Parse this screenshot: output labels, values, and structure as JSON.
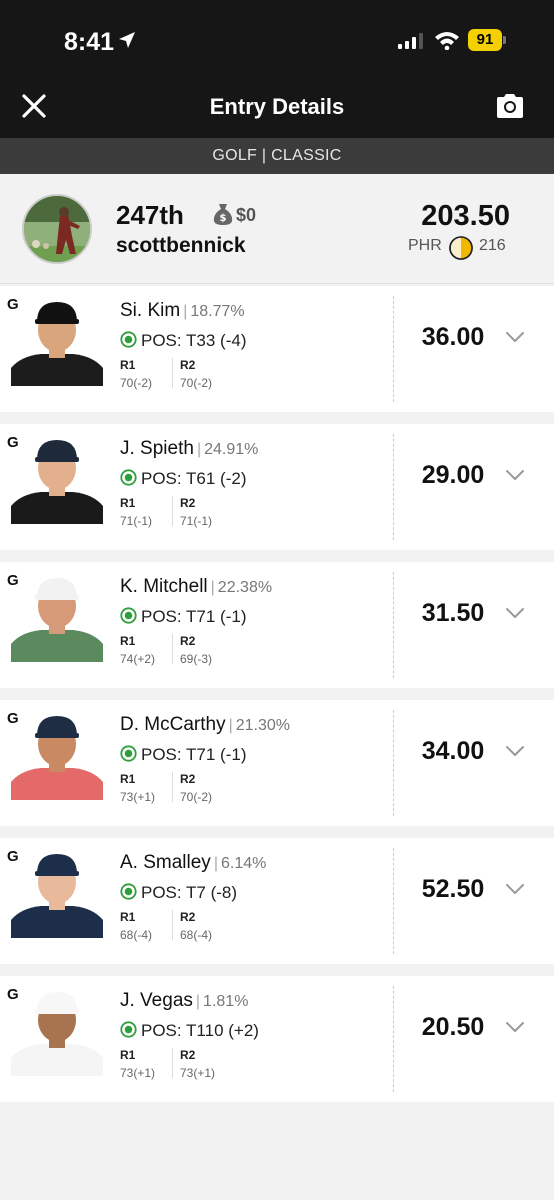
{
  "status_bar": {
    "time": "8:41",
    "battery": "91"
  },
  "header": {
    "title": "Entry Details",
    "close_icon": "close-icon",
    "camera_icon": "camera-icon"
  },
  "subheader": {
    "label": "GOLF | CLASSIC"
  },
  "summary": {
    "rank": "247th",
    "winnings": "$0",
    "username": "scottbennick",
    "score": "203.50",
    "phr_label": "PHR",
    "phr_value": "216"
  },
  "players": [
    {
      "pos": "G",
      "name": "Si. Kim",
      "ownership": "18.77%",
      "status": "POS: T33 (-4)",
      "r1_label": "R1",
      "r1": "70(-2)",
      "r2_label": "R2",
      "r2": "70(-2)",
      "points": "36.00",
      "shirt": "#1c1c1c",
      "cap": "#111111",
      "skin": "#d9a57c"
    },
    {
      "pos": "G",
      "name": "J. Spieth",
      "ownership": "24.91%",
      "status": "POS: T61 (-2)",
      "r1_label": "R1",
      "r1": "71(-1)",
      "r2_label": "R2",
      "r2": "71(-1)",
      "points": "29.00",
      "shirt": "#1a1a1a",
      "cap": "#1e2a3a",
      "skin": "#e3b08e"
    },
    {
      "pos": "G",
      "name": "K. Mitchell",
      "ownership": "22.38%",
      "status": "POS: T71 (-1)",
      "r1_label": "R1",
      "r1": "74(+2)",
      "r2_label": "R2",
      "r2": "69(-3)",
      "points": "31.50",
      "shirt": "#5a8a5e",
      "cap": "#f2f2f2",
      "skin": "#d69a78"
    },
    {
      "pos": "G",
      "name": "D. McCarthy",
      "ownership": "21.30%",
      "status": "POS: T71 (-1)",
      "r1_label": "R1",
      "r1": "73(+1)",
      "r2_label": "R2",
      "r2": "70(-2)",
      "points": "34.00",
      "shirt": "#e46a6a",
      "cap": "#1f2d44",
      "skin": "#c98963"
    },
    {
      "pos": "G",
      "name": "A. Smalley",
      "ownership": "6.14%",
      "status": "POS: T7 (-8)",
      "r1_label": "R1",
      "r1": "68(-4)",
      "r2_label": "R2",
      "r2": "68(-4)",
      "points": "52.50",
      "shirt": "#1d2e4a",
      "cap": "#1d2e4a",
      "skin": "#e8b99a"
    },
    {
      "pos": "G",
      "name": "J. Vegas",
      "ownership": "1.81%",
      "status": "POS: T110 (+2)",
      "r1_label": "R1",
      "r1": "73(+1)",
      "r2_label": "R2",
      "r2": "73(+1)",
      "points": "20.50",
      "shirt": "#f5f5f5",
      "cap": "#f7f7f7",
      "skin": "#a8734f"
    }
  ],
  "colors": {
    "header_bg": "#161616",
    "subbar_bg": "#3b3b3b",
    "status_green": "#2e9e3a",
    "battery": "#f4d000",
    "phr_gold": "#f1b800"
  }
}
